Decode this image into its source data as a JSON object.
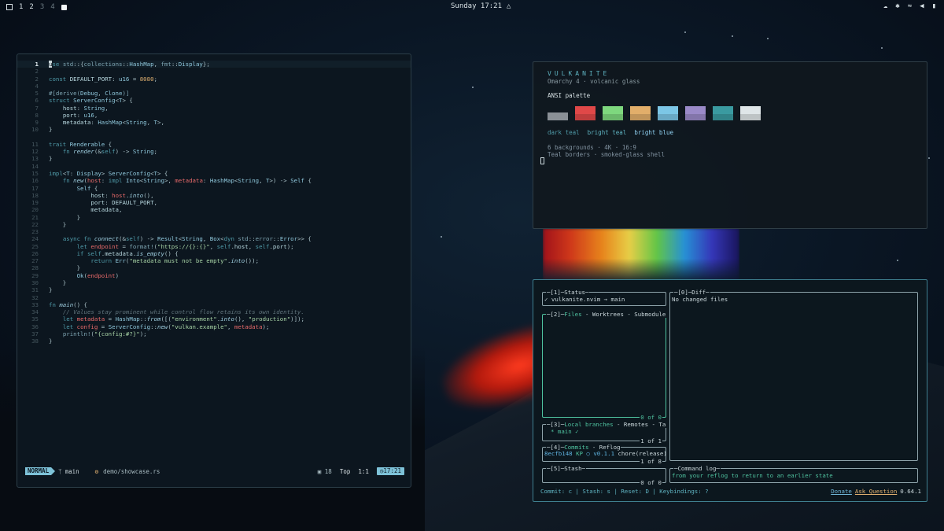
{
  "topbar": {
    "workspaces": [
      "1",
      "2",
      "3",
      "4"
    ],
    "clock": "Sunday 17:21"
  },
  "editor": {
    "lines": [
      {
        "n": "1",
        "html": "<span class=\"cur-char\">u</span><span class=\"k\">se</span> <span class=\"m\">std</span>::{<span class=\"m\">collections</span>::<span class=\"t\">HashMap</span>, <span class=\"m\">fmt</span>::<span class=\"t\">Display</span>};"
      },
      {
        "n": "2",
        "html": ""
      },
      {
        "n": "2",
        "html": "<span class=\"k\">const</span> <span class=\"p\">DEFAULT_PORT</span>: <span class=\"t\">u16</span> = <span class=\"n\">8080</span>;"
      },
      {
        "n": "4",
        "html": ""
      },
      {
        "n": "5",
        "html": "<span class=\"m\">#[derive(</span><span class=\"t\">Debug</span>, <span class=\"t\">Clone</span><span class=\"m\">)]</span>"
      },
      {
        "n": "6",
        "html": "<span class=\"k\">struct</span> <span class=\"t\">ServerConfig</span>&lt;<span class=\"t\">T</span>&gt; {"
      },
      {
        "n": "7",
        "html": "    <span class=\"p\">host</span>: <span class=\"t\">String</span>,"
      },
      {
        "n": "8",
        "html": "    <span class=\"p\">port</span>: <span class=\"t\">u16</span>,"
      },
      {
        "n": "9",
        "html": "    <span class=\"p\">metadata</span>: <span class=\"t\">HashMap</span>&lt;<span class=\"t\">String</span>, <span class=\"t\">T</span>&gt;,"
      },
      {
        "n": "10",
        "html": "}"
      },
      {
        "n": "",
        "html": ""
      },
      {
        "n": "11",
        "html": "<span class=\"k\">trait</span> <span class=\"t\">Renderable</span> {"
      },
      {
        "n": "12",
        "html": "    <span class=\"k\">fn</span> <span class=\"f\">render</span>(&amp;<span class=\"k\">self</span>) -&gt; <span class=\"t\">String</span>;"
      },
      {
        "n": "13",
        "html": "}"
      },
      {
        "n": "14",
        "html": ""
      },
      {
        "n": "15",
        "html": "<span class=\"k\">impl</span>&lt;<span class=\"t\">T</span>: <span class=\"t\">Display</span>&gt; <span class=\"t\">ServerConfig</span>&lt;<span class=\"t\">T</span>&gt; {"
      },
      {
        "n": "16",
        "html": "    <span class=\"k\">fn</span> <span class=\"f\">new</span>(<span class=\"red\">host</span>: <span class=\"k\">impl</span> <span class=\"t\">Into</span>&lt;<span class=\"t\">String</span>&gt;, <span class=\"red\">metadata</span>: <span class=\"t\">HashMap</span>&lt;<span class=\"t\">String</span>, <span class=\"t\">T</span>&gt;) -&gt; <span class=\"t\">Self</span> {"
      },
      {
        "n": "17",
        "html": "        <span class=\"t\">Self</span> {"
      },
      {
        "n": "18",
        "html": "            <span class=\"p\">host</span>: <span class=\"red\">host</span>.<span class=\"f\">into</span>(),"
      },
      {
        "n": "19",
        "html": "            <span class=\"p\">port</span>: <span class=\"p\">DEFAULT_PORT</span>,"
      },
      {
        "n": "20",
        "html": "            <span class=\"p\">metadata</span>,"
      },
      {
        "n": "21",
        "html": "        }"
      },
      {
        "n": "22",
        "html": "    }"
      },
      {
        "n": "23",
        "html": ""
      },
      {
        "n": "24",
        "html": "    <span class=\"k\">async</span> <span class=\"k\">fn</span> <span class=\"f\">connect</span>(&amp;<span class=\"k\">self</span>) -&gt; <span class=\"t\">Result</span>&lt;<span class=\"t\">String</span>, <span class=\"t\">Box</span>&lt;<span class=\"k\">dyn</span> <span class=\"m\">std</span>::<span class=\"m\">error</span>::<span class=\"t\">Error</span>&gt;&gt; {"
      },
      {
        "n": "25",
        "html": "        <span class=\"k\">let</span> <span class=\"red\">endpoint</span> = <span class=\"m\">format!</span>(<span class=\"s\">\"https://{}:{}\"</span>, <span class=\"k\">self</span>.<span class=\"p\">host</span>, <span class=\"k\">self</span>.<span class=\"p\">port</span>);"
      },
      {
        "n": "26",
        "html": "        <span class=\"k\">if</span> <span class=\"k\">self</span>.<span class=\"p\">metadata</span>.<span class=\"f\">is_empty</span>() {"
      },
      {
        "n": "27",
        "html": "            <span class=\"k\">return</span> <span class=\"t\">Err</span>(<span class=\"s\">\"metadata must not be empty\"</span>.<span class=\"f\">into</span>());"
      },
      {
        "n": "28",
        "html": "        }"
      },
      {
        "n": "29",
        "html": "        <span class=\"t\">Ok</span>(<span class=\"red\">endpoint</span>)"
      },
      {
        "n": "30",
        "html": "    }"
      },
      {
        "n": "31",
        "html": "}"
      },
      {
        "n": "32",
        "html": ""
      },
      {
        "n": "33",
        "html": "<span class=\"k\">fn</span> <span class=\"f\">main</span>() {"
      },
      {
        "n": "34",
        "html": "    <span class=\"c\">// Values stay prominent while control flow retains its own identity.</span>"
      },
      {
        "n": "35",
        "html": "    <span class=\"k\">let</span> <span class=\"red\">metadata</span> = <span class=\"t\">HashMap</span>::<span class=\"f\">from</span>([(<span class=\"s\">\"environment\"</span>.<span class=\"f\">into</span>(), <span class=\"s\">\"production\"</span>)]);"
      },
      {
        "n": "36",
        "html": "    <span class=\"k\">let</span> <span class=\"red\">config</span> = <span class=\"t\">ServerConfig</span>::<span class=\"f\">new</span>(<span class=\"s\">\"vulkan.example\"</span>, <span class=\"red\">metadata</span>);"
      },
      {
        "n": "37",
        "html": "    <span class=\"m\">println!</span>(<span class=\"s\">\"{config:#?}\"</span>);"
      },
      {
        "n": "38",
        "html": "}"
      }
    ],
    "status": {
      "mode": "NORMAL",
      "branch": "main",
      "file": "demo/showcase.rs",
      "lsp_count": "18",
      "scroll": "Top",
      "position": "1:1",
      "time": "17:21"
    }
  },
  "vulkanite": {
    "title": "VULKANITE",
    "subtitle": "Omarchy 4 · volcanic glass",
    "palette_label": "ANSI palette",
    "swatches": [
      "#8a9096",
      "#e04848",
      "#7ed87e",
      "#e2ae6a",
      "#7cc6e6",
      "#9a8ac8",
      "#3a9aa0",
      "#dfe6e8"
    ],
    "labels": [
      {
        "text": "dark teal",
        "color": "#4f9aa8"
      },
      {
        "text": "bright teal",
        "color": "#5fb3c1"
      },
      {
        "text": "bright blue",
        "color": "#8fd0f0"
      }
    ],
    "meta1": "6 backgrounds · 4K · 16:9",
    "meta2": "Teal borders · smoked-glass shell"
  },
  "lazygit": {
    "status": {
      "title_num": "[1]",
      "title": "Status",
      "body": "✓ vulkanite.nvim → main"
    },
    "files": {
      "title_num": "[2]",
      "title_hl": "Files",
      "title_rest": " - Worktrees - Submodule",
      "count": "0 of 0"
    },
    "branches": {
      "title_num": "[3]",
      "title_hl": "Local branches",
      "title_rest": " - Remotes - Ta",
      "body_marker": "*",
      "body_branch": "main",
      "body_check": "✓",
      "count": "1 of 1"
    },
    "commits": {
      "title_num": "[4]",
      "title_hl": "Commits",
      "title_rest": " - Reflog",
      "hash": "8ecfb148",
      "author": "KP",
      "circle": "○",
      "tag": "v0.1.1",
      "msg": "chore(release)",
      "count": "1 of 8"
    },
    "stash": {
      "title_num": "[5]",
      "title": "Stash",
      "count": "0 of 0"
    },
    "diff": {
      "title_num": "[0]",
      "title": "Diff",
      "body": "No changed files"
    },
    "cmdlog": {
      "title": "Command log",
      "body": "from your reflog to return to an earlier state"
    },
    "footer": {
      "keys": "Commit: c | Stash: s | Reset: D | Keybindings: ?",
      "donate": "Donate",
      "ask": "Ask Question",
      "version": "0.64.1"
    }
  }
}
